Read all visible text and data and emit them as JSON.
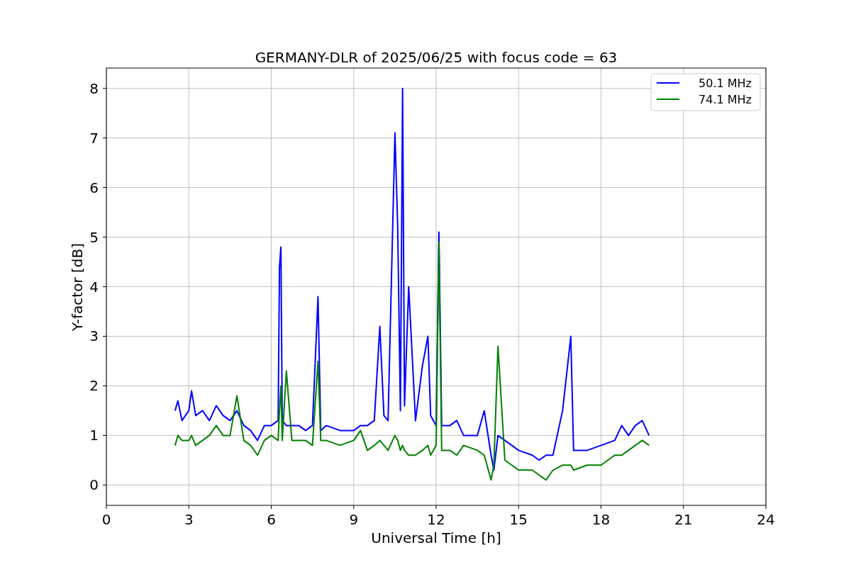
{
  "figure": {
    "chart_data": {
      "type": "line",
      "title": "GERMANY-DLR of 2025/06/25 with focus code = 63",
      "xlabel": "Universal Time [h]",
      "ylabel": "Y-factor [dB]",
      "x": [
        2.5,
        2.6,
        2.75,
        3.0,
        3.1,
        3.25,
        3.5,
        3.75,
        4.0,
        4.25,
        4.5,
        4.75,
        5.0,
        5.25,
        5.5,
        5.75,
        6.0,
        6.25,
        6.3,
        6.35,
        6.4,
        6.55,
        6.75,
        7.0,
        7.25,
        7.5,
        7.7,
        7.8,
        8.0,
        8.5,
        9.0,
        9.25,
        9.5,
        9.75,
        9.95,
        10.1,
        10.25,
        10.5,
        10.6,
        10.7,
        10.78,
        10.85,
        11.0,
        11.25,
        11.5,
        11.7,
        11.8,
        12.0,
        12.1,
        12.2,
        12.5,
        12.75,
        13.0,
        13.5,
        13.75,
        14.0,
        14.1,
        14.25,
        14.5,
        14.75,
        15.0,
        15.5,
        15.75,
        16.0,
        16.25,
        16.6,
        16.9,
        17.0,
        17.5,
        18.0,
        18.5,
        18.75,
        19.0,
        19.25,
        19.5,
        19.75
      ],
      "series": [
        {
          "name": "50.1 MHz",
          "color": "#0000ff",
          "values": [
            1.5,
            1.7,
            1.3,
            1.5,
            1.9,
            1.4,
            1.5,
            1.3,
            1.6,
            1.4,
            1.3,
            1.5,
            1.2,
            1.1,
            0.9,
            1.2,
            1.2,
            1.3,
            4.4,
            4.8,
            1.3,
            1.2,
            1.2,
            1.2,
            1.1,
            1.2,
            3.8,
            1.1,
            1.2,
            1.1,
            1.1,
            1.2,
            1.2,
            1.3,
            3.2,
            1.4,
            1.3,
            7.1,
            5.2,
            1.5,
            8.0,
            1.6,
            4.0,
            1.3,
            2.4,
            3.0,
            1.4,
            1.2,
            5.1,
            1.2,
            1.2,
            1.3,
            1.0,
            1.0,
            1.5,
            0.6,
            0.3,
            1.0,
            0.9,
            0.8,
            0.7,
            0.6,
            0.5,
            0.6,
            0.6,
            1.5,
            3.0,
            0.7,
            0.7,
            0.8,
            0.9,
            1.2,
            1.0,
            1.2,
            1.3,
            1.0
          ]
        },
        {
          "name": "74.1 MHz",
          "color": "#008000",
          "values": [
            0.8,
            1.0,
            0.9,
            0.9,
            1.0,
            0.8,
            0.9,
            1.0,
            1.2,
            1.0,
            1.0,
            1.8,
            0.9,
            0.8,
            0.6,
            0.9,
            1.0,
            0.9,
            1.5,
            2.0,
            0.9,
            2.3,
            0.9,
            0.9,
            0.9,
            0.8,
            2.5,
            0.9,
            0.9,
            0.8,
            0.9,
            1.1,
            0.7,
            0.8,
            0.9,
            0.8,
            0.7,
            1.0,
            0.9,
            0.7,
            0.8,
            0.7,
            0.6,
            0.6,
            0.7,
            0.8,
            0.6,
            0.8,
            4.9,
            0.7,
            0.7,
            0.6,
            0.8,
            0.7,
            0.6,
            0.1,
            0.4,
            2.8,
            0.5,
            0.4,
            0.3,
            0.3,
            0.2,
            0.1,
            0.3,
            0.4,
            0.4,
            0.3,
            0.4,
            0.4,
            0.6,
            0.6,
            0.7,
            0.8,
            0.9,
            0.8
          ]
        }
      ],
      "grid": true,
      "legend": "upper right",
      "xlim": [
        0,
        24
      ],
      "ylim": [
        -0.41,
        8.41
      ],
      "xticks": [
        0,
        3,
        6,
        9,
        12,
        15,
        18,
        21,
        24
      ],
      "yticks": [
        0,
        1,
        2,
        3,
        4,
        5,
        6,
        7,
        8
      ]
    }
  }
}
